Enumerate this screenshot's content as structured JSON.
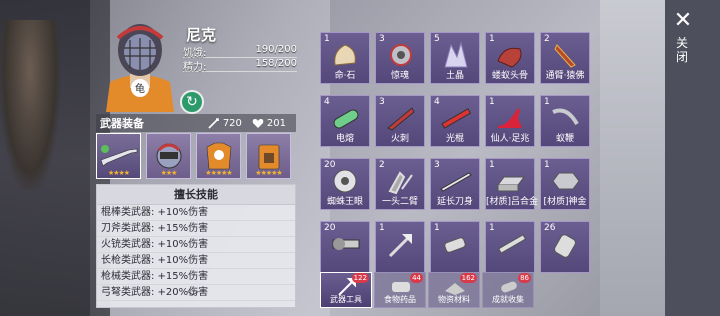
{
  "character": {
    "name": "尼克",
    "hunger_label": "饥饿:",
    "hunger_value": "190/200",
    "energy_label": "精力:",
    "energy_value": "158/200"
  },
  "equipment": {
    "label": "武器装备",
    "attack": "720",
    "health": "201",
    "slots": [
      {
        "name": "rifle",
        "stars": "★★★★"
      },
      {
        "name": "helmet",
        "stars": "★★★"
      },
      {
        "name": "armor",
        "stars": "★★★★★"
      },
      {
        "name": "backpack",
        "stars": "★★★★★"
      }
    ]
  },
  "skills": {
    "title": "擅长技能",
    "rows": [
      "棍棒类武器: +10%伤害",
      "刀斧类武器: +15%伤害",
      "火铳类武器: +10%伤害",
      "长枪类武器: +10%伤害",
      "枪械类武器: +15%伤害",
      "弓弩类武器: +20%伤害"
    ]
  },
  "inventory": [
    {
      "qty": "1",
      "name": "命·石",
      "icon": "shell-icon"
    },
    {
      "qty": "3",
      "name": "惊魂",
      "icon": "gear-icon"
    },
    {
      "qty": "5",
      "name": "土晶",
      "icon": "crystal-icon"
    },
    {
      "qty": "1",
      "name": "蝼蚁头骨",
      "icon": "skull-icon"
    },
    {
      "qty": "2",
      "name": "通臂·猿佛",
      "icon": "arm-icon"
    },
    {
      "qty": "4",
      "name": "电熔",
      "icon": "capsule-icon"
    },
    {
      "qty": "3",
      "name": "火刺",
      "icon": "spike-icon"
    },
    {
      "qty": "4",
      "name": "光棍",
      "icon": "rod-icon"
    },
    {
      "qty": "1",
      "name": "仙人·足兆",
      "icon": "heel-icon"
    },
    {
      "qty": "1",
      "name": "蚁鞭",
      "icon": "whip-icon"
    },
    {
      "qty": "20",
      "name": "蜘蛛王眼",
      "icon": "eye-icon"
    },
    {
      "qty": "2",
      "name": "一头二臂",
      "icon": "claw-icon"
    },
    {
      "qty": "3",
      "name": "延长刀身",
      "icon": "blade-icon"
    },
    {
      "qty": "1",
      "name": "[材质]吕合金",
      "icon": "ingot-icon"
    },
    {
      "qty": "1",
      "name": "[材质]神金",
      "icon": "nut-icon"
    },
    {
      "qty": "20",
      "name": "",
      "icon": "scope-icon"
    },
    {
      "qty": "1",
      "name": "",
      "icon": "axe-icon"
    },
    {
      "qty": "1",
      "name": "",
      "icon": "spray-icon"
    },
    {
      "qty": "1",
      "name": "",
      "icon": "stick-icon"
    },
    {
      "qty": "26",
      "name": "",
      "icon": "bottle-icon"
    }
  ],
  "tabs": [
    {
      "label": "武器工具",
      "count": "122",
      "active": true
    },
    {
      "label": "食物药品",
      "count": "44",
      "active": false
    },
    {
      "label": "物资材料",
      "count": "162",
      "active": false
    },
    {
      "label": "成就收集",
      "count": "86",
      "active": false
    }
  ],
  "close": {
    "label": "关闭"
  }
}
